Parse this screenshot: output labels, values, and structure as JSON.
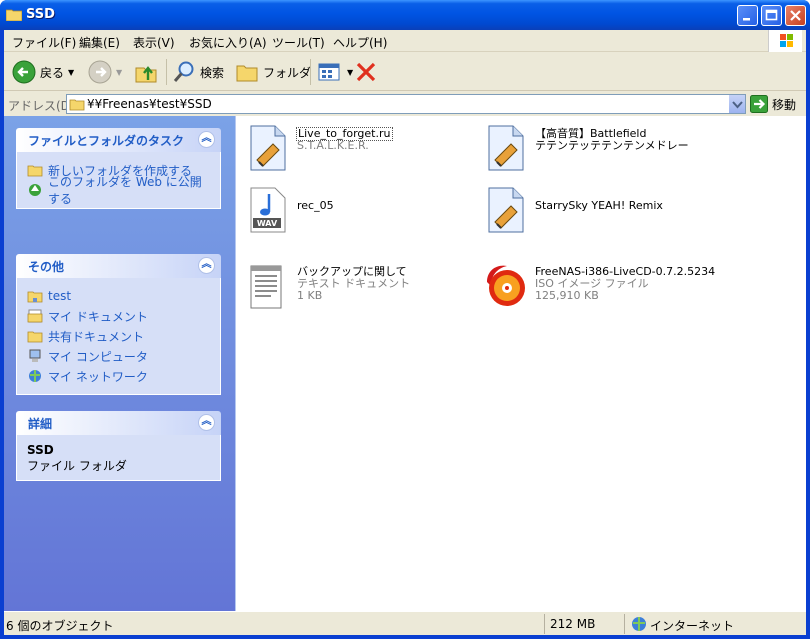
{
  "window": {
    "title": "SSD"
  },
  "menu": [
    "ファイル(F)",
    "編集(E)",
    "表示(V)",
    "お気に入り(A)",
    "ツール(T)",
    "ヘルプ(H)"
  ],
  "toolbar": {
    "back": "戻る",
    "search": "検索",
    "folders": "フォルダ"
  },
  "address": {
    "label": "アドレス(D)",
    "value": "¥¥Freenas¥test¥SSD",
    "go": "移動"
  },
  "tasks": {
    "title": "ファイルとフォルダのタスク",
    "items": [
      "新しいフォルダを作成する",
      "このフォルダを Web に公開する"
    ]
  },
  "other": {
    "title": "その他",
    "items": [
      "test",
      "マイ ドキュメント",
      "共有ドキュメント",
      "マイ コンピュータ",
      "マイ ネットワーク"
    ]
  },
  "details": {
    "title": "詳細",
    "name": "SSD",
    "type": "ファイル フォルダ"
  },
  "files": [
    {
      "name": "Live_to_forget.ru",
      "meta1": "S.T.A.L.K.E.R.",
      "meta2": "",
      "icon": "winamp-icon"
    },
    {
      "name": "【高音質】Battlefield",
      "meta1": "",
      "meta2": "",
      "name2": "テテンテッテテンテンメドレー",
      "icon": "winamp-icon"
    },
    {
      "name": "rec_05",
      "meta1": "",
      "meta2": "",
      "icon": "wav-icon"
    },
    {
      "name": "StarrySky YEAH! Remix",
      "meta1": "",
      "meta2": "",
      "icon": "winamp-icon"
    },
    {
      "name": "バックアップに関して",
      "meta1": "テキスト ドキュメント",
      "meta2": "1 KB",
      "icon": "text-document-icon"
    },
    {
      "name": "FreeNAS-i386-LiveCD-0.7.2.5234",
      "meta1": "ISO イメージ ファイル",
      "meta2": "125,910 KB",
      "icon": "iso-disc-icon"
    }
  ],
  "status": {
    "objects": "6 個のオブジェクト",
    "size": "212 MB",
    "zone": "インターネット"
  }
}
